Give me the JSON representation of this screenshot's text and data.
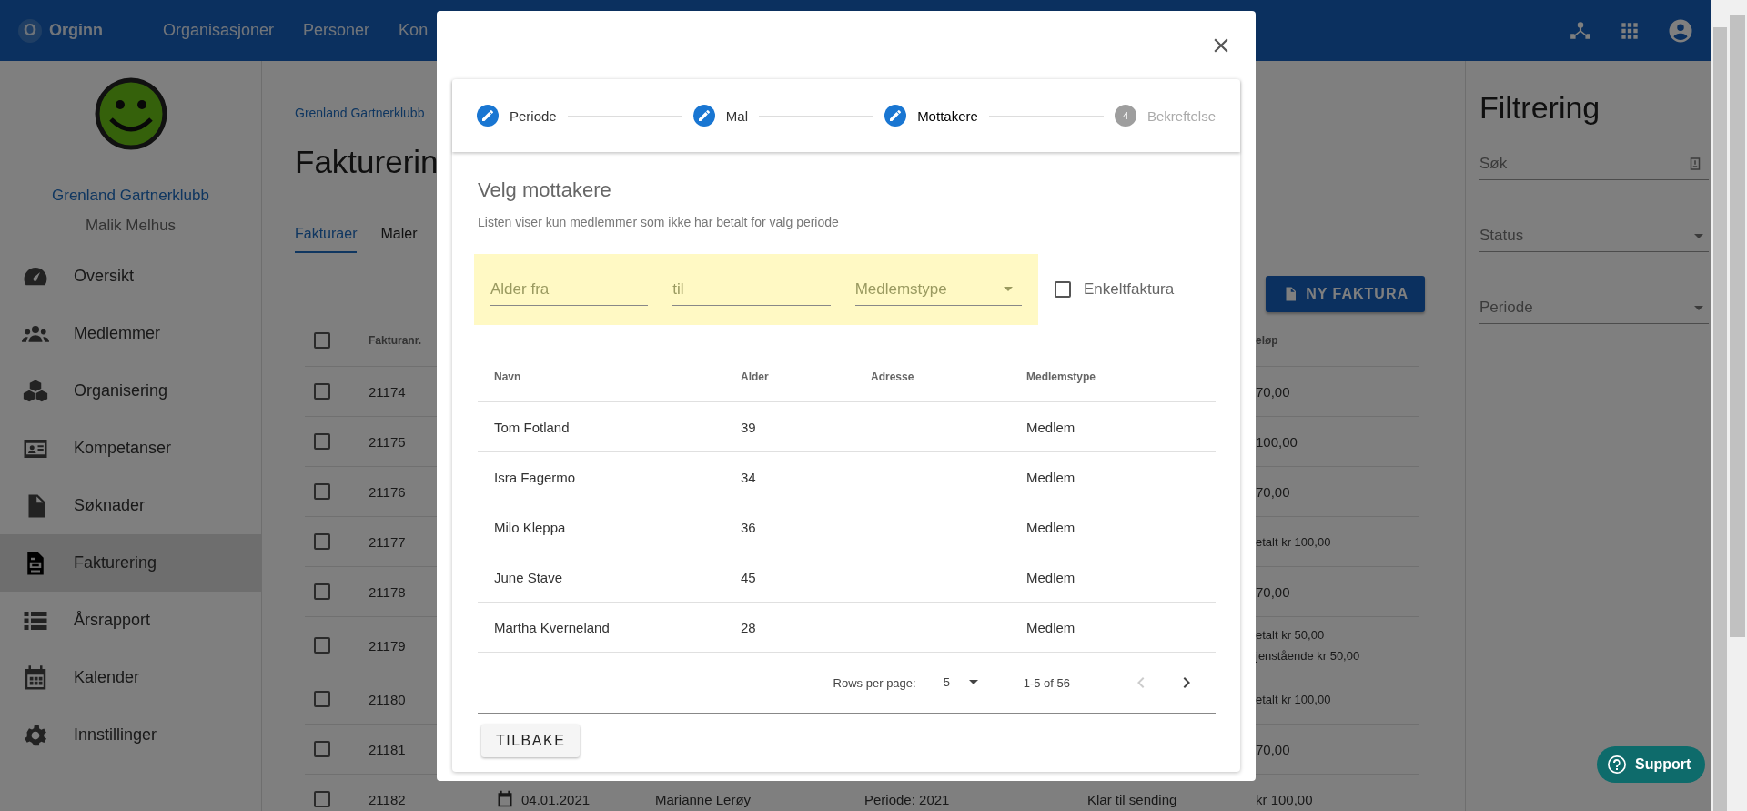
{
  "topbar": {
    "logo_letter": "O",
    "brand": "Orginn",
    "nav": [
      {
        "label": "Organisasjoner"
      },
      {
        "label": "Personer"
      },
      {
        "label": "Kon"
      }
    ]
  },
  "sidebar": {
    "org_name": "Grenland Gartnerklubb",
    "user": "Malik Melhus",
    "items": [
      {
        "label": "Oversikt",
        "kind": "gauge",
        "selected": false
      },
      {
        "label": "Medlemmer",
        "kind": "people",
        "selected": false
      },
      {
        "label": "Organisering",
        "kind": "cubes",
        "selected": false
      },
      {
        "label": "Kompetanser",
        "kind": "card",
        "selected": false
      },
      {
        "label": "Søknader",
        "kind": "document",
        "selected": false
      },
      {
        "label": "Fakturering",
        "kind": "invoice",
        "selected": true
      },
      {
        "label": "Årsrapport",
        "kind": "list",
        "selected": false
      },
      {
        "label": "Kalender",
        "kind": "calendar",
        "selected": false
      },
      {
        "label": "Innstillinger",
        "kind": "gear",
        "selected": false
      }
    ]
  },
  "page": {
    "breadcrumb": "Grenland Gartnerklubb",
    "title": "Fakturerin",
    "tabs": [
      {
        "label": "Fakturaer",
        "selected": true
      },
      {
        "label": "Maler",
        "selected": false
      }
    ],
    "new_button": "NY FAKTURA",
    "table": {
      "all_checked": false,
      "header": {
        "invoice_no": "Fakturanr.",
        "amount": "eløp"
      },
      "rows": [
        {
          "checked": false,
          "invoice_no": "21174",
          "amount": [
            "70,00"
          ]
        },
        {
          "checked": false,
          "invoice_no": "21175",
          "amount": [
            "100,00"
          ]
        },
        {
          "checked": false,
          "invoice_no": "21176",
          "amount": [
            "70,00"
          ]
        },
        {
          "checked": false,
          "invoice_no": "21177",
          "amount": [
            "etalt kr 100,00"
          ]
        },
        {
          "checked": false,
          "invoice_no": "21178",
          "amount": [
            "70,00"
          ]
        },
        {
          "checked": false,
          "invoice_no": "21179",
          "amount": [
            "etalt kr 50,00",
            "jenstående kr 50,00"
          ]
        },
        {
          "checked": false,
          "invoice_no": "21180",
          "amount": [
            "etalt kr 100,00"
          ]
        },
        {
          "checked": false,
          "invoice_no": "21181",
          "amount": [
            "70,00"
          ]
        },
        {
          "checked": false,
          "invoice_no": "21182",
          "date": "04.01.2021",
          "name": "Marianne Lerøy",
          "period": "Periode: 2021",
          "status": "Klar til sending",
          "amount": [
            "kr 100,00"
          ]
        }
      ]
    }
  },
  "filter": {
    "title": "Filtrering",
    "search": {
      "placeholder": "Søk"
    },
    "selects": [
      {
        "placeholder": "Status"
      },
      {
        "placeholder": "Periode"
      }
    ]
  },
  "support": "Support",
  "modal": {
    "steps": [
      {
        "label": "Periode",
        "completed": true,
        "selected": false
      },
      {
        "label": "Mal",
        "completed": true,
        "selected": false
      },
      {
        "label": "Mottakere",
        "completed": true,
        "selected": true
      },
      {
        "label": "Bekreftelse",
        "completed": false,
        "selected": false,
        "number": "4"
      }
    ],
    "heading": "Velg mottakere",
    "subtitle": "Listen viser kun medlemmer som ikke har betalt for valg periode",
    "filters": {
      "age_from": {
        "placeholder": "Alder fra"
      },
      "age_to": {
        "placeholder": "til"
      },
      "member_type": {
        "placeholder": "Medlemstype"
      },
      "single_invoice": {
        "label": "Enkeltfaktura",
        "checked": false
      }
    },
    "table": {
      "columns": [
        "Navn",
        "Alder",
        "Adresse",
        "Medlemstype"
      ],
      "rows": [
        {
          "name": "Tom Fotland",
          "age": "39",
          "member_type": "Medlem"
        },
        {
          "name": "Isra Fagermo",
          "age": "34",
          "member_type": "Medlem"
        },
        {
          "name": "Milo Kleppa",
          "age": "36",
          "member_type": "Medlem"
        },
        {
          "name": "June Stave",
          "age": "45",
          "member_type": "Medlem"
        },
        {
          "name": "Martha Kverneland",
          "age": "28",
          "member_type": "Medlem"
        }
      ]
    },
    "pagination": {
      "rows_per_page_label": "Rows per page:",
      "rows_per_page": "5",
      "range": "1-5 of 56",
      "prev": {
        "disabled": true
      },
      "next": {
        "disabled": false
      }
    },
    "back_button": "TILBAKE"
  }
}
